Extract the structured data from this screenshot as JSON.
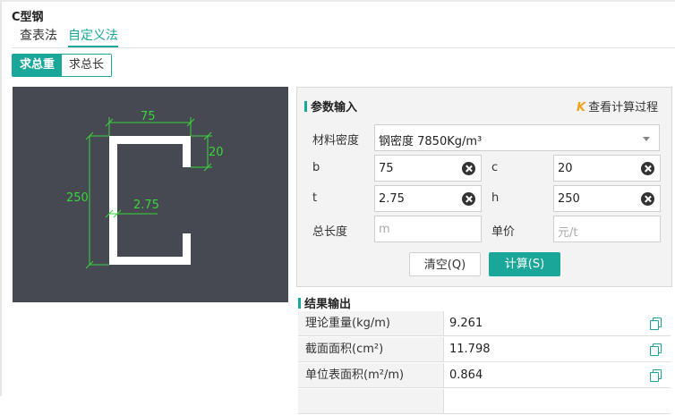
{
  "title": "C型钢",
  "tabs": [
    "查表法",
    "自定义法"
  ],
  "segment": {
    "total_weight": "求总重",
    "total_length": "求总长"
  },
  "diagram": {
    "width_label": "75",
    "lip_label": "20",
    "height_label": "250",
    "thickness_label": "2.75"
  },
  "params": {
    "section_title": "参数输入",
    "view_calc": "查看计算过程",
    "density_label": "材料密度",
    "density_value": "钢密度 7850Kg/m³",
    "b_label": "b",
    "b_value": "75",
    "c_label": "c",
    "c_value": "20",
    "t_label": "t",
    "t_value": "2.75",
    "h_label": "h",
    "h_value": "250",
    "length_label": "总长度",
    "length_placeholder": "m",
    "price_label": "单价",
    "price_placeholder": "元/t",
    "clear_button": "清空(Q)",
    "calc_button": "计算(S)"
  },
  "results": {
    "section_title": "结果输出",
    "rows": [
      {
        "label": "理论重量(kg/m)",
        "value": "9.261"
      },
      {
        "label": "截面面积(cm²)",
        "value": "11.798"
      },
      {
        "label": "单位表面积(m²/m)",
        "value": "0.864"
      }
    ]
  },
  "colors": {
    "accent": "#1aa79a",
    "canvas_bg": "#464852",
    "dimension": "#39d63a"
  }
}
